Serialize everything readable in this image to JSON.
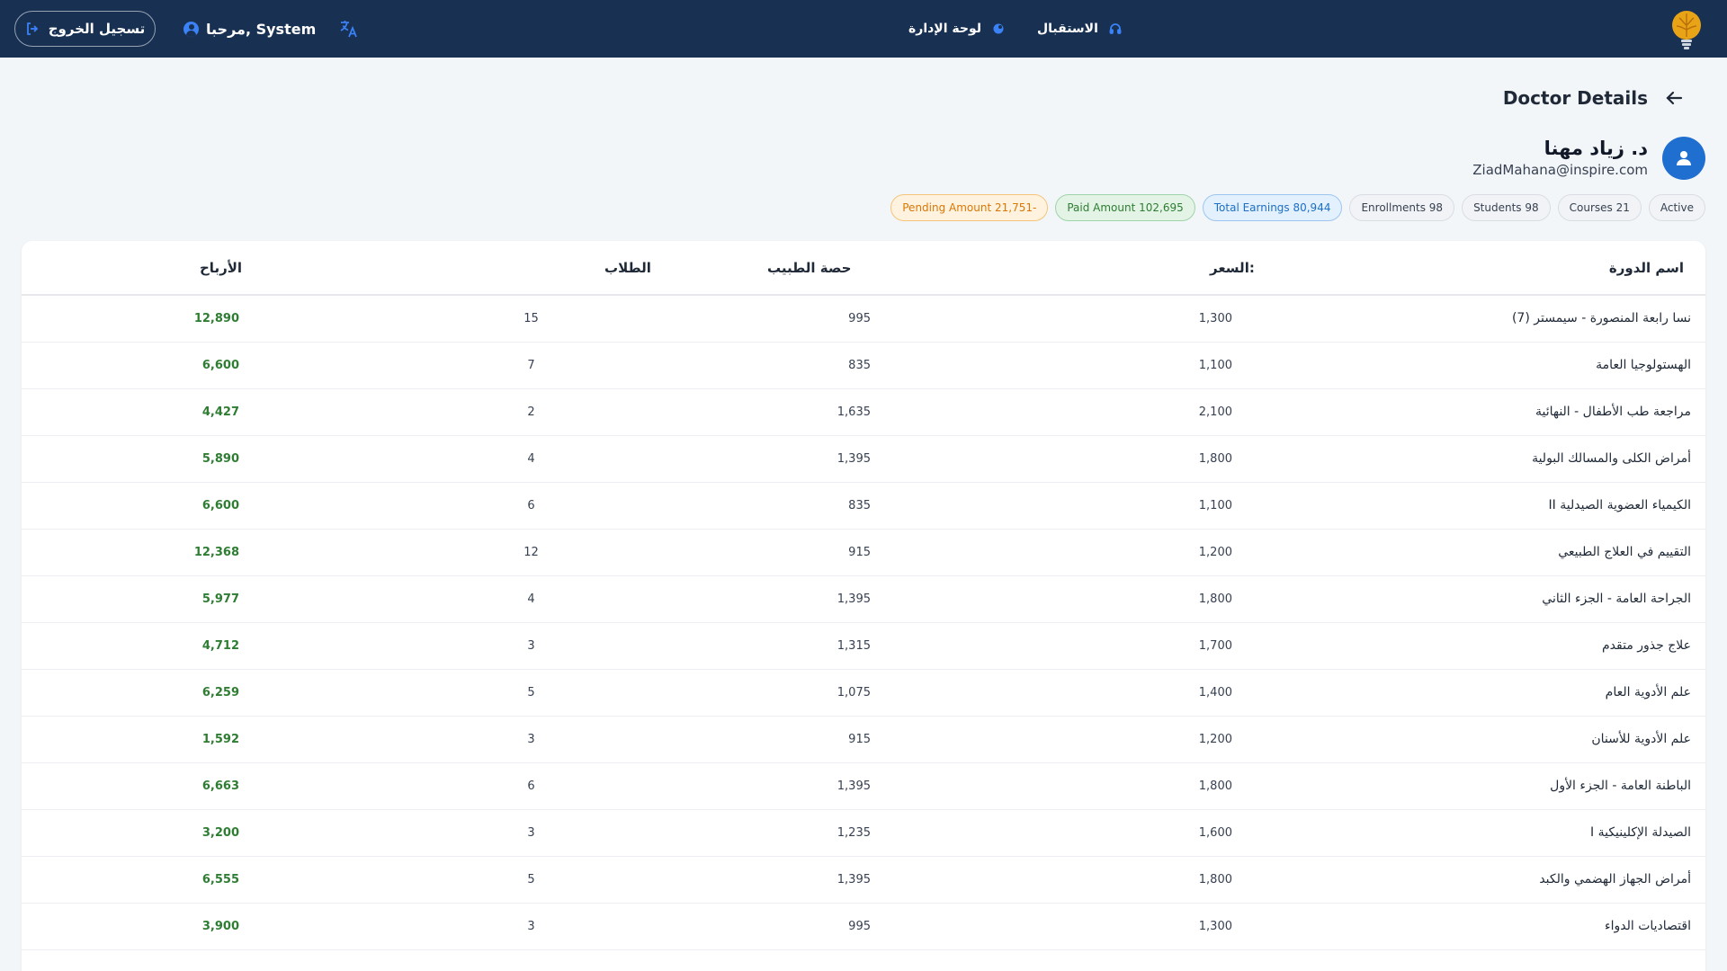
{
  "topbar": {
    "logout_label": "تسجيل الخروج",
    "welcome_text": "مرحبا, System",
    "nav": [
      {
        "label": "لوحة الإدارة"
      },
      {
        "label": "الاستقبال"
      }
    ]
  },
  "page": {
    "title": "Doctor Details"
  },
  "doctor": {
    "name": "د. زياد مهنا",
    "email": "ZiadMahana@inspire.com"
  },
  "badges": {
    "pending": "Pending Amount 21,751-",
    "paid": "Paid Amount 102,695",
    "earnings": "Total Earnings 80,944",
    "enrollments": "Enrollments 98",
    "students": "Students 98",
    "courses": "Courses 21",
    "status": "Active"
  },
  "colors": {
    "topbar_bg": "#183153",
    "accent_blue": "#1f6fd1",
    "earnings_green": "#2e7d32",
    "pending_orange": "#d97706"
  },
  "table": {
    "headers": {
      "course_name": "اسم الدورة",
      "price": "السعر:",
      "doctor_share": "حصة الطبيب",
      "students": "الطلاب",
      "earnings": "الأرباح"
    },
    "rows": [
      {
        "name": "نسا رابعة المنصورة - سيمستر (7)",
        "price": "1,300",
        "share": "995",
        "students": "15",
        "earnings": "12,890"
      },
      {
        "name": "الهستولوجيا العامة",
        "price": "1,100",
        "share": "835",
        "students": "7",
        "earnings": "6,600"
      },
      {
        "name": "مراجعة طب الأطفال - النهائية",
        "price": "2,100",
        "share": "1,635",
        "students": "2",
        "earnings": "4,427"
      },
      {
        "name": "أمراض الكلى والمسالك البولية",
        "price": "1,800",
        "share": "1,395",
        "students": "4",
        "earnings": "5,890"
      },
      {
        "name": "الكيمياء العضوية الصيدلية II",
        "price": "1,100",
        "share": "835",
        "students": "6",
        "earnings": "6,600"
      },
      {
        "name": "التقييم في العلاج الطبيعي",
        "price": "1,200",
        "share": "915",
        "students": "12",
        "earnings": "12,368"
      },
      {
        "name": "الجراحة العامة - الجزء الثاني",
        "price": "1,800",
        "share": "1,395",
        "students": "4",
        "earnings": "5,977"
      },
      {
        "name": "علاج جذور متقدم",
        "price": "1,700",
        "share": "1,315",
        "students": "3",
        "earnings": "4,712"
      },
      {
        "name": "علم الأدوية العام",
        "price": "1,400",
        "share": "1,075",
        "students": "5",
        "earnings": "6,259"
      },
      {
        "name": "علم الأدوية للأسنان",
        "price": "1,200",
        "share": "915",
        "students": "3",
        "earnings": "1,592"
      },
      {
        "name": "الباطنة العامة - الجزء الأول",
        "price": "1,800",
        "share": "1,395",
        "students": "6",
        "earnings": "6,663"
      },
      {
        "name": "الصيدلة الإكلينيكية I",
        "price": "1,600",
        "share": "1,235",
        "students": "3",
        "earnings": "3,200"
      },
      {
        "name": "أمراض الجهاز الهضمي والكبد",
        "price": "1,800",
        "share": "1,395",
        "students": "5",
        "earnings": "6,555"
      },
      {
        "name": "اقتصاديات الدواء",
        "price": "1,300",
        "share": "995",
        "students": "3",
        "earnings": "3,900"
      }
    ]
  }
}
